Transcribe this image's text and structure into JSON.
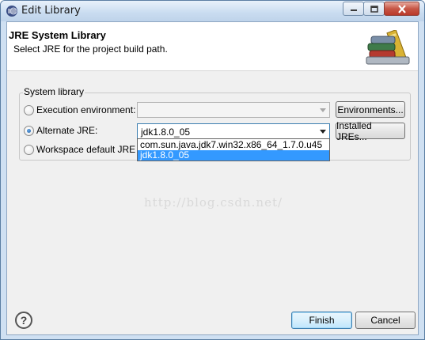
{
  "window": {
    "title": "Edit Library"
  },
  "header": {
    "title": "JRE System Library",
    "description": "Select JRE for the project build path."
  },
  "group": {
    "label": "System library"
  },
  "options": {
    "execution_env": {
      "label": "Execution environment:",
      "value": "",
      "button": "Environments...",
      "selected": false
    },
    "alternate_jre": {
      "label": "Alternate JRE:",
      "value": "jdk1.8.0_05",
      "button": "Installed JREs...",
      "selected": true
    },
    "workspace_default": {
      "label": "Workspace default JRE (jd",
      "selected": false
    }
  },
  "dropdown": {
    "items": [
      "com.sun.java.jdk7.win32.x86_64_1.7.0.u45",
      "jdk1.8.0_05"
    ],
    "selected_index": 1
  },
  "watermark": "http://blog.csdn.net/",
  "footer": {
    "finish": "Finish",
    "cancel": "Cancel",
    "help": "?"
  },
  "colors": {
    "selection": "#3399ff",
    "focus_border": "#3c7fb1"
  },
  "icons": {
    "app": "eclipse-icon",
    "header": "library-books-icon"
  }
}
